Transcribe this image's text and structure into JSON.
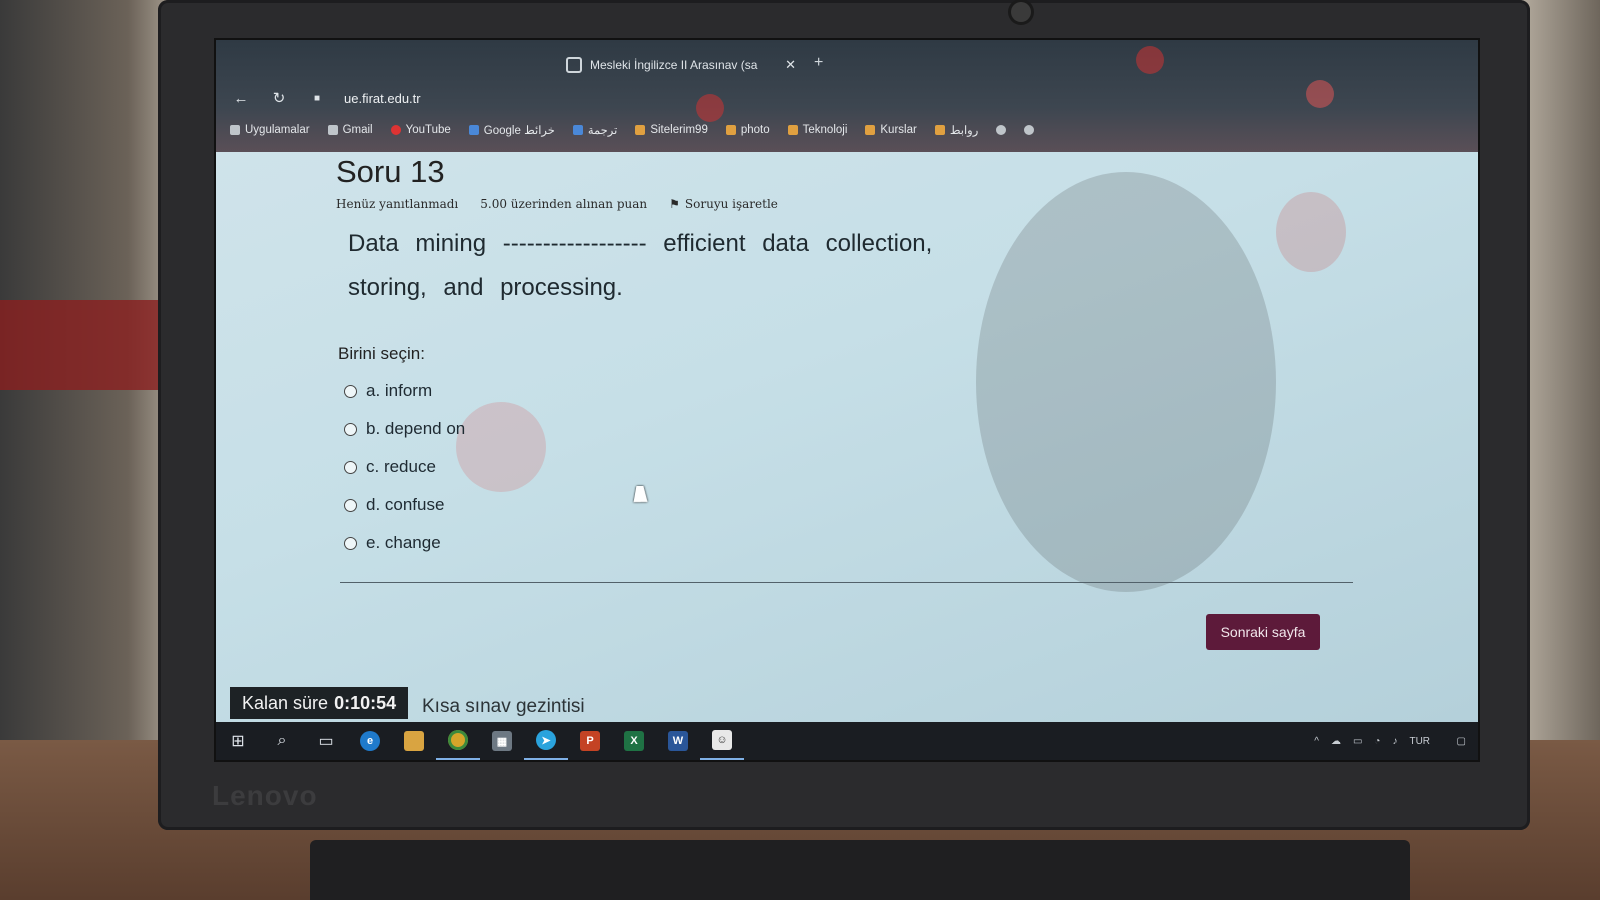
{
  "browser": {
    "tab_title": "Mesleki İngilizce II Arasınav (sa",
    "url": "ue.firat.edu.tr",
    "bookmarks": [
      "Uygulamalar",
      "Gmail",
      "YouTube",
      "Google خرائط",
      "ترجمة",
      "Sitelerim99",
      "photo",
      "Teknoloji",
      "Kurslar",
      "روابط"
    ]
  },
  "quiz": {
    "question_title": "Soru 13",
    "status": "Henüz yanıtlanmadı",
    "score": "5.00 üzerinden alınan puan",
    "flag": "Soruyu işaretle",
    "question_line1": "Data mining ------------------ efficient data collection,",
    "question_line2": "storing, and processing.",
    "prompt": "Birini seçin:",
    "options": [
      "a. inform",
      "b. depend on",
      "c. reduce",
      "d. confuse",
      "e. change"
    ],
    "next_button": "Sonraki sayfa",
    "timer_label": "Kalan süre",
    "timer_value": "0:10:54",
    "quiz_nav": "Kısa sınav gezintisi"
  },
  "laptop": {
    "brand": "Lenovo"
  },
  "taskbar": {
    "apps": [
      "windows-start",
      "search",
      "task-view",
      "edge",
      "file-explorer",
      "chrome",
      "store",
      "telegram",
      "powerpoint",
      "excel",
      "word",
      "contact"
    ],
    "language": "TUR"
  },
  "colors": {
    "accent": "#5d1a3a",
    "page_bg": "#cfe3ea"
  }
}
